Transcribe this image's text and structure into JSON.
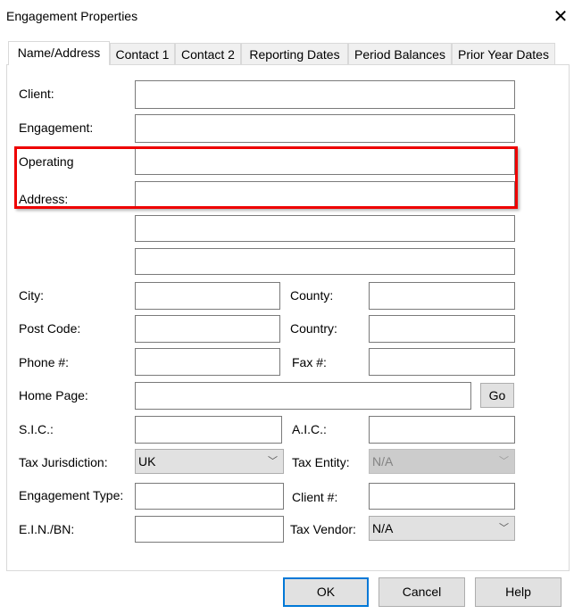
{
  "window": {
    "title": "Engagement Properties",
    "close_icon": "close-icon"
  },
  "tabs": [
    "Name/Address",
    "Contact 1",
    "Contact 2",
    "Reporting Dates",
    "Period Balances",
    "Prior Year Dates"
  ],
  "labels": {
    "client": "Client:",
    "engagement": "Engagement:",
    "operating": "Operating",
    "address": "Address:",
    "city": "City:",
    "county": "County:",
    "post_code": "Post Code:",
    "country": "Country:",
    "phone": "Phone #:",
    "fax": "Fax #:",
    "home_page": "Home Page:",
    "sic": "S.I.C.:",
    "aic": "A.I.C.:",
    "tax_jurisdiction": "Tax Jurisdiction:",
    "tax_entity": "Tax Entity:",
    "engagement_type": "Engagement Type:",
    "client_no": "Client #:",
    "ein": "E.I.N./BN:",
    "tax_vendor": "Tax Vendor:"
  },
  "selects": {
    "tax_jurisdiction": "UK",
    "tax_entity": "N/A",
    "tax_vendor": "N/A"
  },
  "buttons": {
    "go": "Go",
    "ok": "OK",
    "cancel": "Cancel",
    "help": "Help"
  },
  "highlight_color": "#e00000"
}
